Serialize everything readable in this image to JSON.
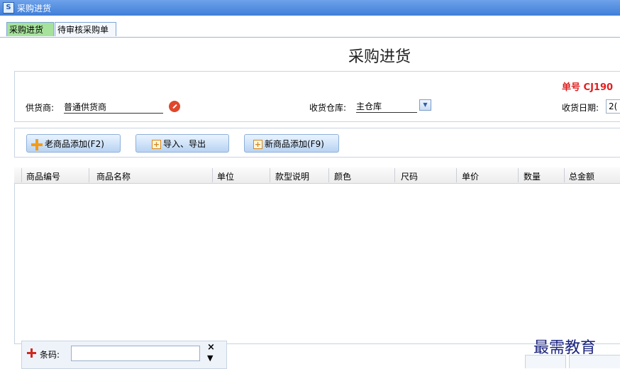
{
  "window": {
    "title": "采购进货"
  },
  "tabs": [
    {
      "label": "采购进货",
      "active": true
    },
    {
      "label": "待审核采购单",
      "active": false
    }
  ],
  "page": {
    "title": "采购进货"
  },
  "header": {
    "order_no_label": "单号",
    "order_no_value": "CJ190",
    "supplier_label": "供货商:",
    "supplier_value": "普通供货商",
    "warehouse_label": "收货仓库:",
    "warehouse_value": "主仓库",
    "date_label": "收货日期:",
    "date_value": "2("
  },
  "toolbar": {
    "add_old": "老商品添加(F2)",
    "import_export": "导入、导出",
    "add_new": "新商品添加(F9)"
  },
  "table": {
    "columns": [
      "商品编号",
      "商品名称",
      "单位",
      "款型说明",
      "颜色",
      "尺码",
      "单价",
      "数量",
      "总金额"
    ],
    "rows": []
  },
  "barcode": {
    "label": "条码:",
    "value": "",
    "clear_glyph": "×",
    "down_glyph": "▼"
  },
  "watermark": "最需教育",
  "colors": {
    "titlebar": "#4a86dd",
    "active_tab": "#a6e29b",
    "order_no": "#e02020"
  }
}
